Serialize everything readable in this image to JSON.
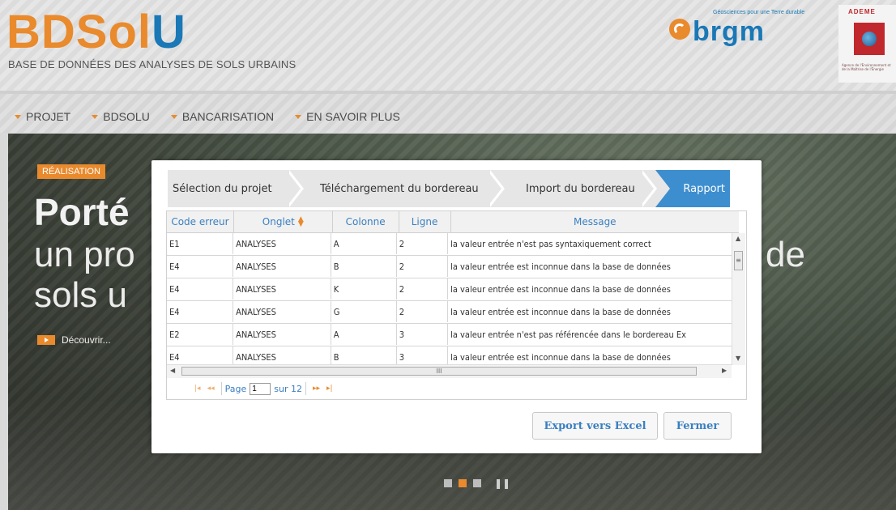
{
  "header": {
    "logo_prefix": "BDSol",
    "logo_suffix": "U",
    "subtitle": "BASE DE DONNÉES DES ANALYSES DE SOLS URBAINS",
    "brgm_word": "brgm",
    "brgm_tagline": "Géosciences pour une Terre durable",
    "ademe_title": "ADEME",
    "ademe_caption": "Agence de l'Environnement et de la Maîtrise de l'Énergie"
  },
  "nav": {
    "items": [
      {
        "label": "PROJET"
      },
      {
        "label": "BDSOLU"
      },
      {
        "label": "BANCARISATION"
      },
      {
        "label": "EN SAVOIR PLUS"
      }
    ]
  },
  "hero": {
    "tag": "RÉALISATION",
    "title": "Porté",
    "sub1": "un pro",
    "sub2": "sols u",
    "right_text": "de",
    "discover": "Découvrir..."
  },
  "modal": {
    "steps": [
      {
        "label": "Sélection du projet"
      },
      {
        "label": "Téléchargement du bordereau"
      },
      {
        "label": "Import du bordereau"
      },
      {
        "label": "Rapport"
      }
    ],
    "active_step": 3,
    "columns": [
      "Code erreur",
      "Onglet",
      "Colonne",
      "Ligne",
      "Message"
    ],
    "rows": [
      [
        "E1",
        "ANALYSES",
        "A",
        "2",
        "la valeur entrée n'est pas syntaxiquement correct"
      ],
      [
        "E4",
        "ANALYSES",
        "B",
        "2",
        "la valeur entrée est inconnue dans la base de données"
      ],
      [
        "E4",
        "ANALYSES",
        "K",
        "2",
        "la valeur entrée est inconnue dans la base de données"
      ],
      [
        "E4",
        "ANALYSES",
        "G",
        "2",
        "la valeur entrée est inconnue dans la base de données"
      ],
      [
        "E2",
        "ANALYSES",
        "A",
        "3",
        "la valeur entrée n'est pas référencée dans le bordereau Ex"
      ],
      [
        "E4",
        "ANALYSES",
        "B",
        "3",
        "la valeur entrée est inconnue dans la base de données"
      ]
    ],
    "pager": {
      "page_label": "Page",
      "page_value": "1",
      "total_label": "sur 12"
    },
    "export_button": "Export vers Excel",
    "close_button": "Fermer"
  },
  "colors": {
    "accent_orange": "#e98a2d",
    "accent_blue": "#3d8ecf"
  }
}
